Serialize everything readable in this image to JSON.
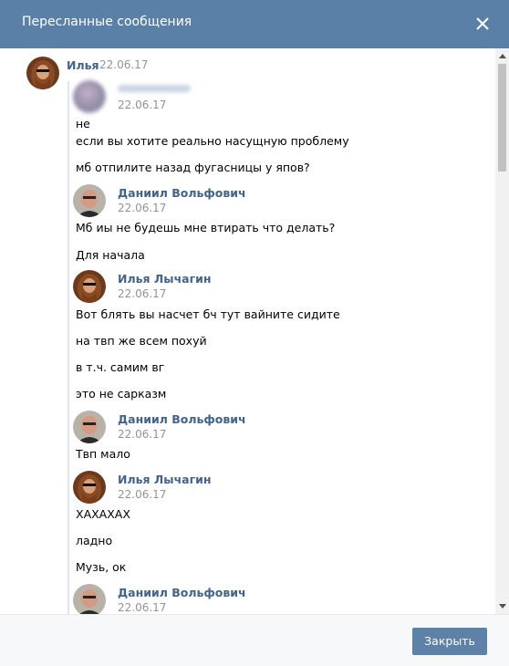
{
  "header": {
    "title": "Пересланные сообщения",
    "close_icon": "close-icon"
  },
  "footer": {
    "close_button": "Закрыть"
  },
  "outer_message": {
    "author": "Илья",
    "date": "22.06.17"
  },
  "forwarded": [
    {
      "author_blurred": true,
      "date": "22.06.17",
      "lines": [
        "не",
        "если вы хотите реально насущную проблему",
        "мб отпилите назад фугасницы у япов?"
      ]
    },
    {
      "author": "Даниил Вольфович",
      "date": "22.06.17",
      "lines": [
        "Мб иы не будешь мне втирать что делать?",
        "Для начала"
      ]
    },
    {
      "author": "Илья Лычагин",
      "date": "22.06.17",
      "lines": [
        "Вот блять вы насчет бч тут вайните сидите",
        "на твп же всем похуй",
        "в т.ч. самим вг",
        "это не сарказм"
      ]
    },
    {
      "author": "Даниил Вольфович",
      "date": "22.06.17",
      "lines": [
        "Твп мало"
      ]
    },
    {
      "author": "Илья Лычагин",
      "date": "22.06.17",
      "lines": [
        "ХАХАХАХ",
        "ладно",
        "Музь, ок"
      ]
    },
    {
      "author": "Даниил Вольфович",
      "date": "22.06.17",
      "lines": []
    }
  ],
  "colors": {
    "header_bg": "#5b80a8",
    "name": "#42648b",
    "date": "#939393",
    "button_bg": "#5e81a8"
  }
}
